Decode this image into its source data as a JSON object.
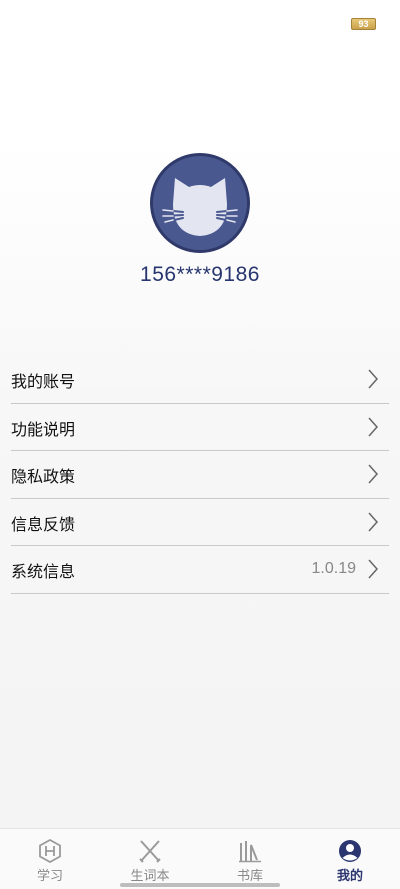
{
  "status_bar": {
    "battery": "93"
  },
  "profile": {
    "avatar_icon": "cat-icon",
    "phone": "156****9186"
  },
  "menu": {
    "items": [
      {
        "label": "我的账号",
        "value": ""
      },
      {
        "label": "功能说明",
        "value": ""
      },
      {
        "label": "隐私政策",
        "value": ""
      },
      {
        "label": "信息反馈",
        "value": ""
      },
      {
        "label": "系统信息",
        "value": "1.0.19"
      }
    ]
  },
  "tabs": [
    {
      "label": "学习",
      "icon": "hexagon-h-icon",
      "active": false
    },
    {
      "label": "生词本",
      "icon": "crossed-pens-icon",
      "active": false
    },
    {
      "label": "书库",
      "icon": "books-icon",
      "active": false
    },
    {
      "label": "我的",
      "icon": "user-circle-icon",
      "active": true
    }
  ],
  "colors": {
    "accent": "#2b3670",
    "avatar_bg": "#4a5890",
    "muted": "#888888"
  }
}
